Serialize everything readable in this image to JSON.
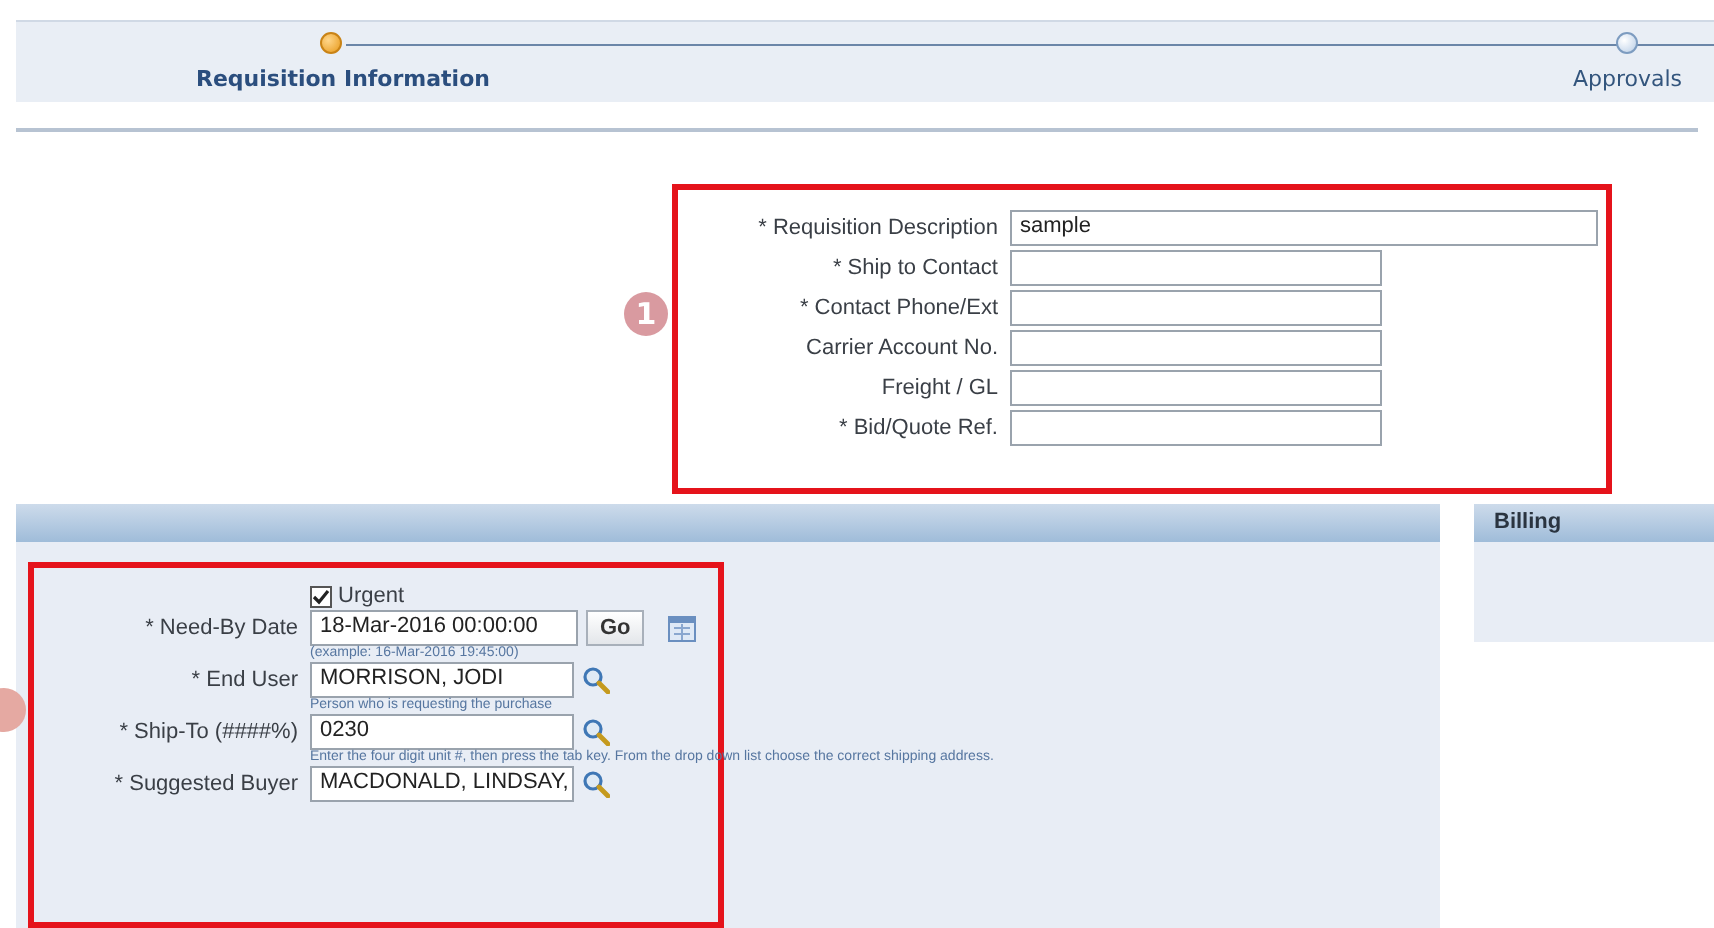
{
  "train": {
    "steps": [
      {
        "label": "Requisition Information",
        "selected": true
      },
      {
        "label": "Approvals",
        "selected": false
      }
    ]
  },
  "callout_1": {
    "badge": "1"
  },
  "header_fields": [
    {
      "kind": "long",
      "label": "* Requisition Description",
      "value": "sample"
    },
    {
      "kind": "short",
      "label": "* Ship to Contact"
    },
    {
      "kind": "short",
      "label": "* Contact Phone/Ext"
    },
    {
      "kind": "short",
      "label": "Carrier Account No."
    },
    {
      "kind": "short",
      "label": "Freight / GL"
    },
    {
      "kind": "short",
      "label": "* Bid/Quote Ref."
    }
  ],
  "details": {
    "urgent": {
      "label": "Urgent",
      "checked": true
    },
    "rows": [
      {
        "kind": "date",
        "label": "* Need-By Date",
        "value": "18-Mar-2016 00:00:00",
        "button": "Go",
        "hint": "(example: 16-Mar-2016 19:45:00)"
      },
      {
        "kind": "lookup",
        "label": "* End User",
        "value": "MORRISON, JODI",
        "hint": "Person who is requesting the purchase"
      },
      {
        "kind": "lookup",
        "label": "* Ship-To (####%)",
        "value": "0230",
        "hint": "Enter the four digit unit #, then press the tab key. From the drop down list choose the correct shipping address."
      },
      {
        "kind": "lookup",
        "label": "* Suggested Buyer",
        "value": "MACDONALD, LINDSAY,"
      }
    ]
  },
  "billing": {
    "title": "Billing"
  }
}
